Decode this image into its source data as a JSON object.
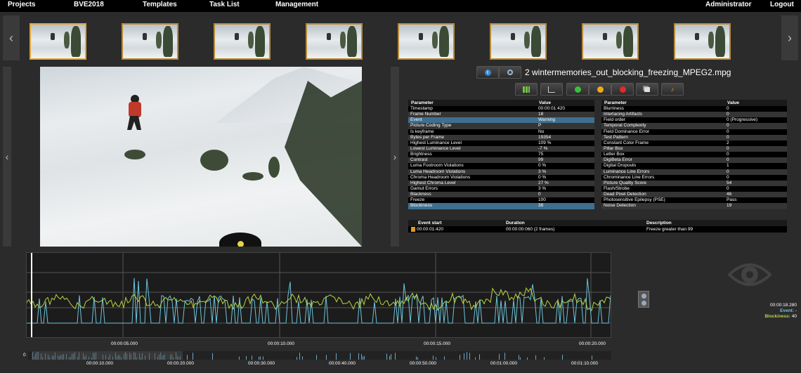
{
  "nav": {
    "left": [
      "Projects",
      "BVE2018",
      "Templates",
      "Task List",
      "Management"
    ],
    "right": [
      "Administrator",
      "Logout"
    ]
  },
  "thumbnails": {
    "count": 8,
    "active_index": 0
  },
  "file_title": "2 wintermemories_out_blocking_freezing_MPEG2.mpg",
  "toolbar": {
    "top_icons": [
      "info-icon",
      "search-icon"
    ],
    "icons": [
      "table-icon",
      "chart-icon",
      "green-dot",
      "yellow-dot",
      "red-dot",
      "copy-icon",
      "sound-icon"
    ],
    "colors": {
      "green": "#39c03a",
      "yellow": "#f0a81c",
      "red": "#e8282a"
    }
  },
  "left_table": {
    "headers": [
      "Parameter",
      "Value"
    ],
    "rows": [
      [
        "Timestamp",
        "00:00:01:420"
      ],
      [
        "Frame Number",
        "18"
      ],
      [
        "Event",
        "Warning"
      ],
      [
        "Picture Coding Type",
        "P"
      ],
      [
        "Is keyframe",
        "No"
      ],
      [
        "Bytes per Frame",
        "19354"
      ],
      [
        "Highest Luminance Level",
        "109 %"
      ],
      [
        "Lowest Luminance Level",
        "-7 %"
      ],
      [
        "Brightness",
        "75"
      ],
      [
        "Contrast",
        "99"
      ],
      [
        "Luma Footroom Violations",
        "0 %"
      ],
      [
        "Luma Headroom Violations",
        "3 %"
      ],
      [
        "Chroma Headroom Violations",
        "0 %"
      ],
      [
        "Highest Chroma Level",
        "27 %"
      ],
      [
        "Gamut Errors",
        "3 %"
      ],
      [
        "Blackness",
        "0"
      ],
      [
        "Freeze",
        "100"
      ],
      [
        "Blockiness",
        "38"
      ]
    ],
    "highlight_rows": [
      2,
      17
    ]
  },
  "right_table": {
    "headers": [
      "Parameter",
      "Value"
    ],
    "rows": [
      [
        "Blurriness",
        "0"
      ],
      [
        "Interlacing Artifacts",
        "0"
      ],
      [
        "Field order",
        "0 (Progressive)"
      ],
      [
        "Temporal Complexity",
        "0"
      ],
      [
        "Field Dominance Error",
        "0"
      ],
      [
        "Test Pattern",
        "0"
      ],
      [
        "Constant Color Frame",
        "2"
      ],
      [
        "Pillar Box",
        "0"
      ],
      [
        "Letter Box",
        "0"
      ],
      [
        "DigiBeta Error",
        "0"
      ],
      [
        "Digital Dropouts",
        "1"
      ],
      [
        "Luminance Line Errors",
        "0"
      ],
      [
        "Chrominance Line Errors",
        "0"
      ],
      [
        "Picture Quality Score",
        "54"
      ],
      [
        "Flash/Strobe",
        "0"
      ],
      [
        "Dead Pixel Detection",
        "46"
      ],
      [
        "Photosensitive Epilepsy (PSE)",
        "Pass"
      ],
      [
        "Noise Detection",
        "19"
      ]
    ]
  },
  "events": {
    "headers": [
      "Event start",
      "Duration",
      "Description"
    ],
    "rows": [
      [
        "00:00:01:420",
        "00:00:00:060 (2 frames)",
        "Freeze greater than 99"
      ]
    ]
  },
  "timeline": {
    "x_labels": [
      "00:00:05.000",
      "00:00:10.000",
      "00:00:15.000",
      "00:00:20.000"
    ],
    "colors": {
      "green": "#b8d442",
      "blue": "#6cc4dc"
    }
  },
  "readout": {
    "time": "00:00:18.280",
    "event_label": "Event:",
    "event_value": "-",
    "metric_label": "Blockiness:",
    "metric_value": "40"
  },
  "overview": {
    "zero_label": "0",
    "labels": [
      "00:00:10.000",
      "00:00:20.000",
      "00:00:30.000",
      "00:00:40.000",
      "00:00:50.000",
      "00:01:00.000",
      "00:01:10.000"
    ]
  }
}
